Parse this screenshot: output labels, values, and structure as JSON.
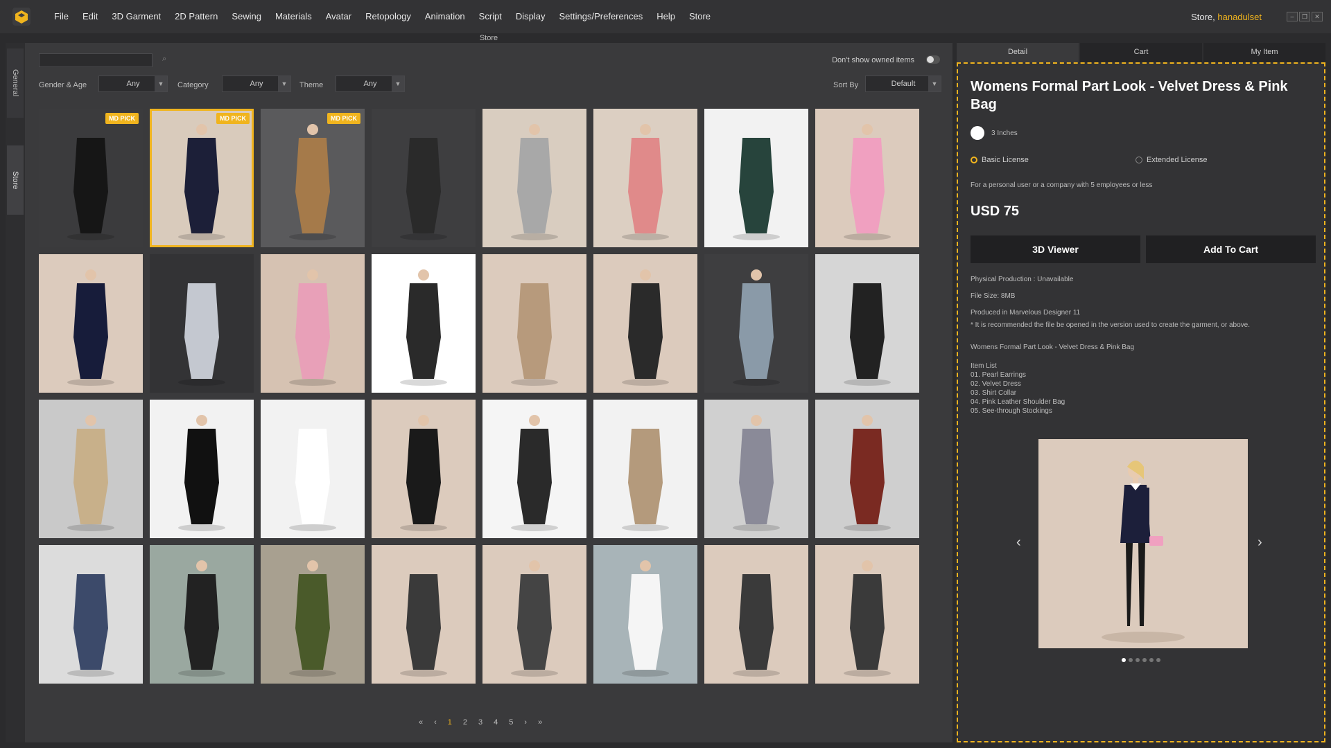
{
  "menu": [
    "File",
    "Edit",
    "3D Garment",
    "2D Pattern",
    "Sewing",
    "Materials",
    "Avatar",
    "Retopology",
    "Animation",
    "Script",
    "Display",
    "Settings/Preferences",
    "Help",
    "Store"
  ],
  "user": {
    "prefix": "Store, ",
    "name": "hanadulset"
  },
  "panel_title": "Store",
  "side_tabs": {
    "general": "General",
    "store": "Store"
  },
  "search": {
    "value": ""
  },
  "filters": {
    "gender_label": "Gender & Age",
    "gender_value": "Any",
    "category_label": "Category",
    "category_value": "Any",
    "theme_label": "Theme",
    "theme_value": "Any",
    "sort_label": "Sort By",
    "sort_value": "Default",
    "owned_label": "Don't show owned items"
  },
  "badge_label": "MD PICK",
  "pagination": {
    "first": "«",
    "prev": "‹",
    "pages": [
      "1",
      "2",
      "3",
      "4",
      "5"
    ],
    "next": "›",
    "last": "»",
    "current": "1"
  },
  "right_tabs": [
    "Detail",
    "Cart",
    "My Item"
  ],
  "detail": {
    "title": "Womens Formal Part Look - Velvet Dress  & Pink Bag",
    "size": "3 Inches",
    "license_basic": "Basic License",
    "license_extended": "Extended License",
    "license_note": "For a personal user or a company with 5 employees or less",
    "price": "USD 75",
    "viewer_btn": "3D Viewer",
    "cart_btn": "Add To Cart",
    "physical": "Physical Production : Unavailable",
    "filesize": "File Size: 8MB",
    "produced": "Produced in Marvelous Designer 11",
    "recommend": "* It is recommended the file be opened in the version used to create the garment, or above.",
    "description": "Womens Formal Part Look - Velvet Dress  & Pink Bag",
    "item_list_title": "Item List",
    "items": [
      "01. Pearl Earrings",
      "02. Velvet Dress",
      "03. Shirt Collar",
      "04. Pink Leather Shoulder Bag",
      "05. See-through Stockings"
    ]
  },
  "grid": [
    {
      "bg": "#3b3b3d",
      "fig": "#161616",
      "badge": true
    },
    {
      "bg": "#d9cbbc",
      "fig": "#1c1f38",
      "badge": true,
      "selected": true
    },
    {
      "bg": "#5a5a5c",
      "fig": "#a57a4a",
      "badge": true
    },
    {
      "bg": "#3e3e40",
      "fig": "#2a2a2a"
    },
    {
      "bg": "#d9cdc0",
      "fig": "#a8a8a8"
    },
    {
      "bg": "#dccfc2",
      "fig": "#e08a8a"
    },
    {
      "bg": "#f2f2f2",
      "fig": "#27443c"
    },
    {
      "bg": "#dccbbd",
      "fig": "#f0a0c0"
    },
    {
      "bg": "#dccbbd",
      "fig": "#171c3a"
    },
    {
      "bg": "#333335",
      "fig": "#c4c8d0"
    },
    {
      "bg": "#d6c2b2",
      "fig": "#e8a0b8"
    },
    {
      "bg": "#ffffff",
      "fig": "#2a2a2a"
    },
    {
      "bg": "#dccbbd",
      "fig": "#b79a7c"
    },
    {
      "bg": "#dccbbd",
      "fig": "#2a2a2a"
    },
    {
      "bg": "#3e3e40",
      "fig": "#8a9aa8"
    },
    {
      "bg": "#d6d6d6",
      "fig": "#222222"
    },
    {
      "bg": "#c9c9c9",
      "fig": "#c8b08a"
    },
    {
      "bg": "#f2f2f2",
      "fig": "#111111"
    },
    {
      "bg": "#f2f2f2",
      "fig": "#ffffff"
    },
    {
      "bg": "#dccbbd",
      "fig": "#1a1a1a"
    },
    {
      "bg": "#f5f5f5",
      "fig": "#2a2a2a"
    },
    {
      "bg": "#f2f2f2",
      "fig": "#b49a7c"
    },
    {
      "bg": "#d0d0d0",
      "fig": "#8a8a98"
    },
    {
      "bg": "#cfcfcf",
      "fig": "#7a2a22"
    },
    {
      "bg": "#dcdcdc",
      "fig": "#3c4a6a"
    },
    {
      "bg": "#9aa8a0",
      "fig": "#222222"
    },
    {
      "bg": "#a8a090",
      "fig": "#4a5a2a"
    },
    {
      "bg": "#dccbbd",
      "fig": "#3a3a3a"
    },
    {
      "bg": "#dccbbd",
      "fig": "#444444"
    },
    {
      "bg": "#a8b4b8",
      "fig": "#f5f5f5"
    },
    {
      "bg": "#dccbbd",
      "fig": "#3a3a3a"
    },
    {
      "bg": "#dccbbd",
      "fig": "#3a3a3a"
    }
  ]
}
